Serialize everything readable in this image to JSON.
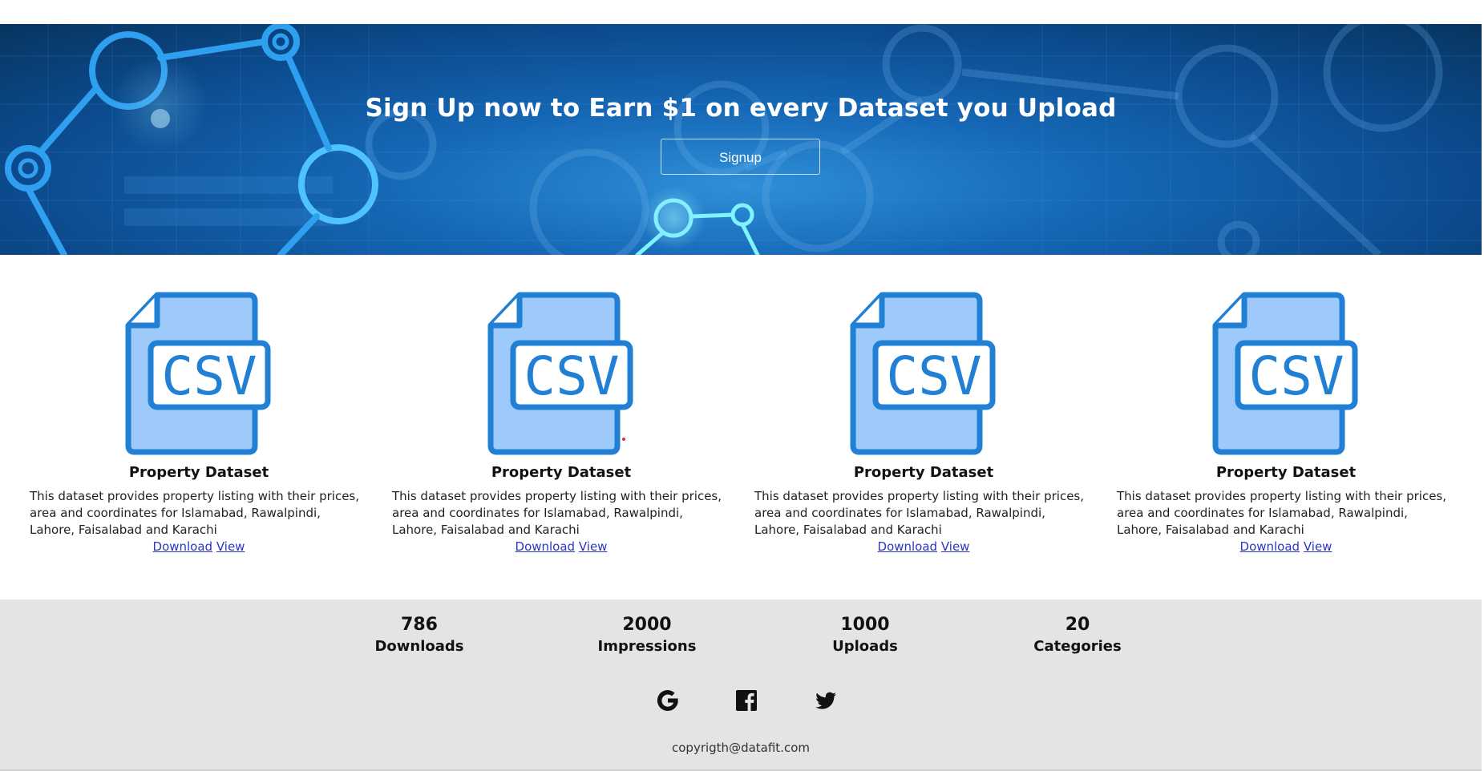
{
  "hero": {
    "title": "Sign Up now to Earn $1 on every Dataset you Upload",
    "signup_label": "Signup"
  },
  "cards": [
    {
      "icon": "csv-file-icon",
      "icon_text": "CSV",
      "title": "Property Dataset",
      "description": "This dataset provides property listing with their prices, area and coordinates for Islamabad, Rawalpindi, Lahore, Faisalabad and Karachi",
      "download_label": "Download",
      "view_label": "View"
    },
    {
      "icon": "csv-file-icon",
      "icon_text": "CSV",
      "title": "Property Dataset",
      "description": "This dataset provides property listing with their prices, area and coordinates for Islamabad, Rawalpindi, Lahore, Faisalabad and Karachi",
      "download_label": "Download",
      "view_label": "View"
    },
    {
      "icon": "csv-file-icon",
      "icon_text": "CSV",
      "title": "Property Dataset",
      "description": "This dataset provides property listing with their prices, area and coordinates for Islamabad, Rawalpindi, Lahore, Faisalabad and Karachi",
      "download_label": "Download",
      "view_label": "View"
    },
    {
      "icon": "csv-file-icon",
      "icon_text": "CSV",
      "title": "Property Dataset",
      "description": "This dataset provides property listing with their prices, area and coordinates for Islamabad, Rawalpindi, Lahore, Faisalabad and Karachi",
      "download_label": "Download",
      "view_label": "View"
    }
  ],
  "stats": [
    {
      "value": "786",
      "label": "Downloads"
    },
    {
      "value": "2000",
      "label": "Impressions"
    },
    {
      "value": "1000",
      "label": "Uploads"
    },
    {
      "value": "20",
      "label": "Categories"
    }
  ],
  "social": [
    {
      "icon": "google-icon"
    },
    {
      "icon": "facebook-icon"
    },
    {
      "icon": "twitter-icon"
    }
  ],
  "footer": {
    "copyright": "copyrigth@datafit.com"
  },
  "colors": {
    "hero_dark": "#08345f",
    "hero_light": "#2f8fd8",
    "csv_icon_fill": "#9ec9fb",
    "csv_icon_stroke": "#2280d4",
    "link": "#2b35c8",
    "footer_bg": "#e4e4e4"
  }
}
